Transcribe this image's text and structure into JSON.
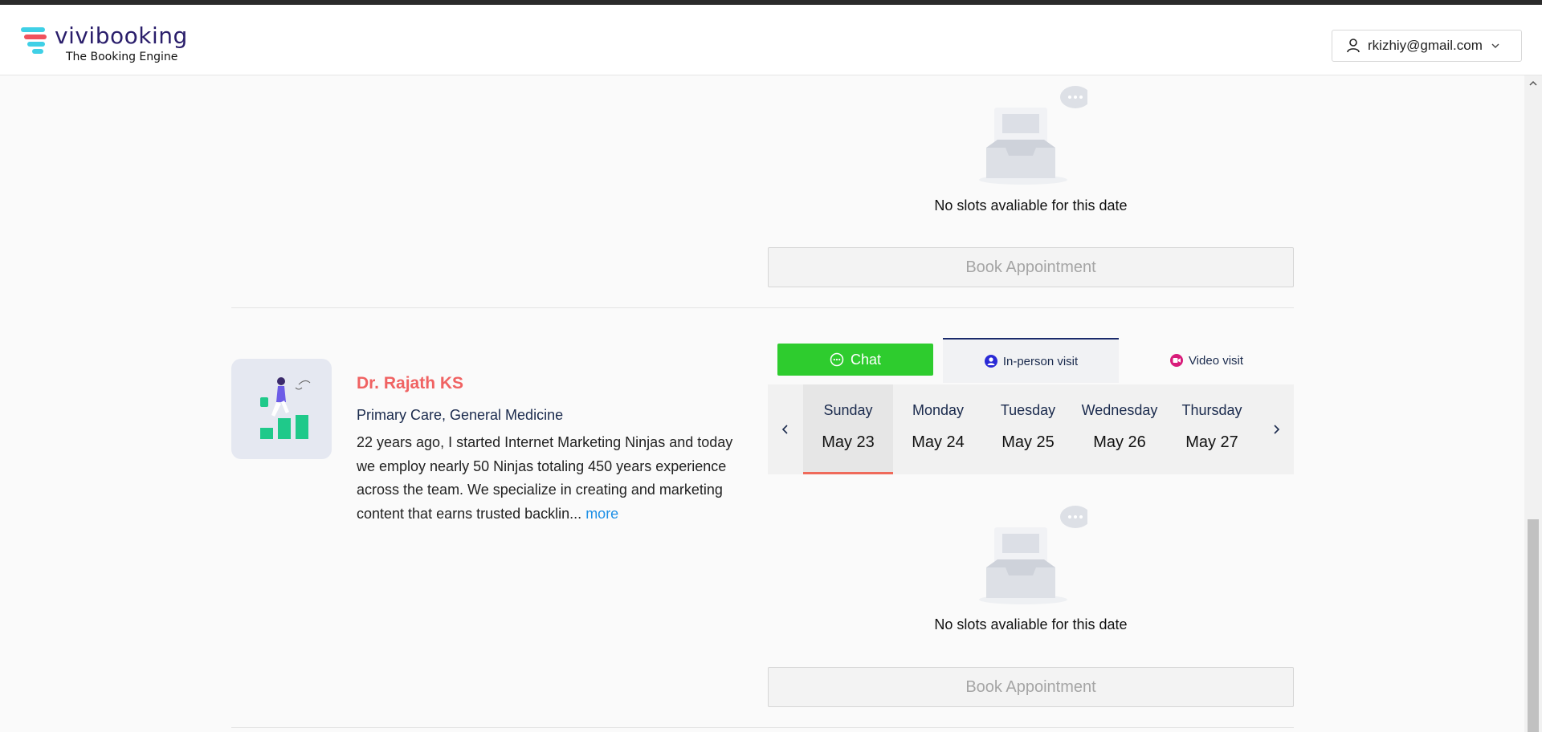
{
  "header": {
    "logo_title": "vivibooking",
    "logo_subtitle": "The Booking Engine",
    "user_email": "rkizhiy@gmail.com"
  },
  "colors": {
    "brand_pink": "#f0525d",
    "brand_cyan": "#3fd0e6",
    "brand_navy": "#2a1e6b",
    "chat_green": "#2ecc2e",
    "doctor_name": "#f06262",
    "link_blue": "#1e90e6",
    "active_date_underline": "#ef6a5a"
  },
  "previous_doctor": {
    "empty_message": "No slots avaliable for this date",
    "book_button": "Book Appointment"
  },
  "doctor": {
    "name": "Dr. Rajath KS",
    "specialty": "Primary Care, General Medicine",
    "bio": "22 years ago, I started Internet Marketing Ninjas and today we employ nearly 50 Ninjas totaling 450 years experience across the team. We specialize in creating and marketing content that earns trusted backlin...",
    "more_link": "more",
    "tabs": {
      "chat": "Chat",
      "in_person": "In-person visit",
      "video": "Video visit"
    },
    "dates": [
      {
        "day": "Sunday",
        "date": "May 23",
        "selected": true
      },
      {
        "day": "Monday",
        "date": "May 24",
        "selected": false
      },
      {
        "day": "Tuesday",
        "date": "May 25",
        "selected": false
      },
      {
        "day": "Wednesday",
        "date": "May 26",
        "selected": false
      },
      {
        "day": "Thursday",
        "date": "May 27",
        "selected": false
      }
    ],
    "empty_message": "No slots avaliable for this date",
    "book_button": "Book Appointment"
  }
}
